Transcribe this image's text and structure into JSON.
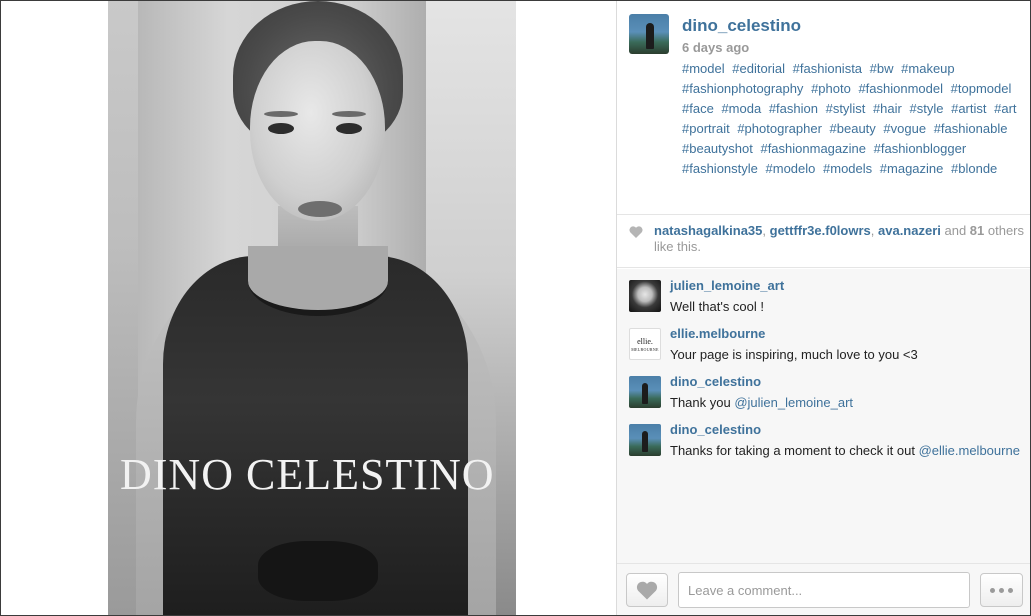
{
  "post": {
    "watermark": "DINO CELESTINO"
  },
  "header": {
    "username": "dino_celestino",
    "time": "6 days ago",
    "hashtags": [
      "#model",
      "#editorial",
      "#fashionista",
      "#bw",
      "#makeup",
      "#fashionphotography",
      "#photo",
      "#fashionmodel",
      "#topmodel",
      "#face",
      "#moda",
      "#fashion",
      "#stylist",
      "#hair",
      "#style",
      "#artist",
      "#art",
      "#portrait",
      "#photographer",
      "#beauty",
      "#vogue",
      "#fashionable",
      "#beautyshot",
      "#fashionmagazine",
      "#fashionblogger",
      "#fashionstyle",
      "#modelo",
      "#models",
      "#magazine",
      "#blonde"
    ]
  },
  "likes": {
    "users": [
      "natashagalkina35",
      "gettffr3e.f0lowrs",
      "ava.nazeri"
    ],
    "sep": ", ",
    "and": " and ",
    "count": "81",
    "suffix": " others like this."
  },
  "comments": [
    {
      "user": "julien_lemoine_art",
      "text": "Well that's cool !",
      "avatar": "skull"
    },
    {
      "user": "ellie.melbourne",
      "text": "Your page is inspiring, much love to you <3",
      "avatar": "ellie",
      "avatar_text": "ellie.",
      "avatar_sub": "MELBOURNE"
    },
    {
      "user": "dino_celestino",
      "text": "Thank you ",
      "mention": "@julien_lemoine_art",
      "avatar": "dino"
    },
    {
      "user": "dino_celestino",
      "text": "Thanks for taking a moment to check it out ",
      "mention": "@ellie.melbourne",
      "avatar": "dino"
    }
  ],
  "footer": {
    "comment_placeholder": "Leave a comment..."
  },
  "icons": {
    "like": "heart-icon",
    "more": "more-options-icon"
  },
  "colors": {
    "link": "#3f729b",
    "muted": "#999999",
    "panel_bg": "#f7f7f7"
  }
}
